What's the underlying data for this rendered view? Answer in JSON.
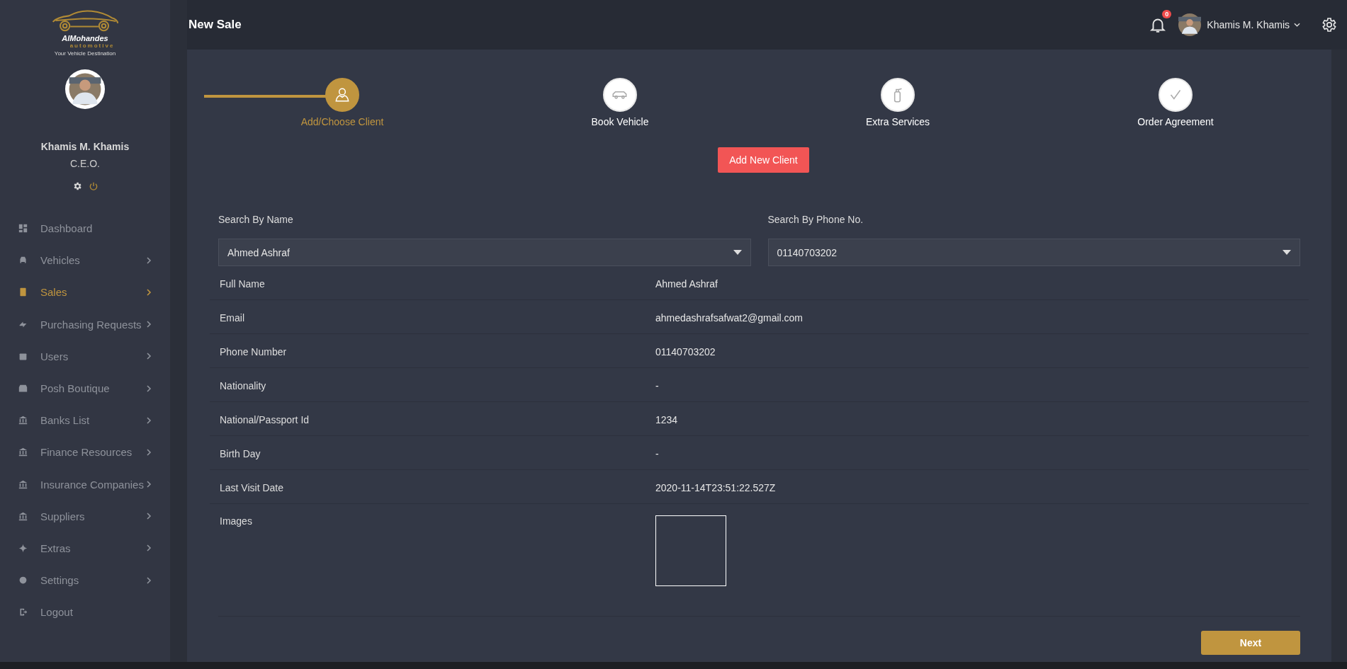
{
  "logo": {
    "name": "AlMohandes",
    "sub": "automotive",
    "tagline": "Your Vehicle Destination"
  },
  "profile": {
    "name": "Khamis M. Khamis",
    "role": "C.E.O."
  },
  "sidebar": {
    "items": [
      {
        "label": "Dashboard",
        "selected": false,
        "has_children": false
      },
      {
        "label": "Vehicles",
        "selected": false,
        "has_children": true
      },
      {
        "label": "Sales",
        "selected": true,
        "has_children": true
      },
      {
        "label": "Purchasing Requests",
        "selected": false,
        "has_children": true
      },
      {
        "label": "Users",
        "selected": false,
        "has_children": true
      },
      {
        "label": "Posh Boutique",
        "selected": false,
        "has_children": true
      },
      {
        "label": "Banks List",
        "selected": false,
        "has_children": true
      },
      {
        "label": "Finance Resources",
        "selected": false,
        "has_children": true
      },
      {
        "label": "Insurance Companies",
        "selected": false,
        "has_children": true
      },
      {
        "label": "Suppliers",
        "selected": false,
        "has_children": true
      },
      {
        "label": "Extras",
        "selected": false,
        "has_children": true
      },
      {
        "label": "Settings",
        "selected": false,
        "has_children": true
      },
      {
        "label": "Logout",
        "selected": false,
        "has_children": false
      }
    ]
  },
  "header": {
    "title": "New Sale",
    "notification_count": "0",
    "user": "Khamis M. Khamis"
  },
  "steps": [
    {
      "label": "Add/Choose Client",
      "selected": true
    },
    {
      "label": "Book Vehicle",
      "selected": false
    },
    {
      "label": "Extra Services",
      "selected": false
    },
    {
      "label": "Order Agreement",
      "selected": false
    }
  ],
  "add_button": "Add New Client",
  "search": [
    {
      "label": "Search By Name",
      "value": "Ahmed Ashraf"
    },
    {
      "label": "Search By Phone No.",
      "value": "01140703202"
    }
  ],
  "details": [
    {
      "label": "Full Name",
      "value": "Ahmed Ashraf"
    },
    {
      "label": "Email",
      "value": "ahmedashrafsafwat2@gmail.com"
    },
    {
      "label": "Phone Number",
      "value": "01140703202"
    },
    {
      "label": "Nationality",
      "value": "-"
    },
    {
      "label": "National/Passport Id",
      "value": "1234"
    },
    {
      "label": "Birth Day",
      "value": "-"
    },
    {
      "label": "Last Visit Date",
      "value": "2020-11-14T23:51:22.527Z"
    }
  ],
  "images": {
    "label": "Images",
    "thumbnails": [
      {
        "kind": "empty"
      }
    ]
  },
  "next_button": "Next"
}
